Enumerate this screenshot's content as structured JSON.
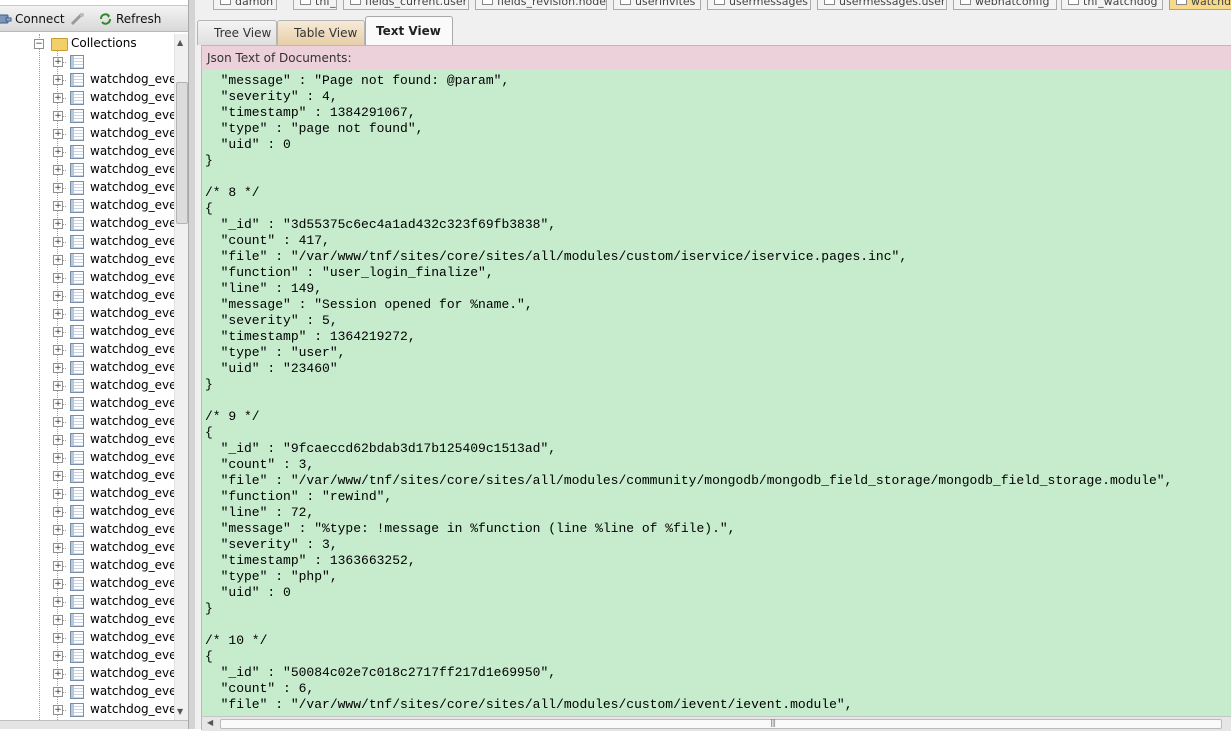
{
  "toolbar": {
    "connect_label": "Connect",
    "refresh_label": "Refresh"
  },
  "tree": {
    "collections_label": "Collections",
    "first_item_label": "",
    "item_label": "watchdog_ever",
    "item_count": 37
  },
  "doc_tabs": [
    "damon",
    "tnf_core",
    "fields_current.user",
    "fields_revision.node",
    "userinvites",
    "usermessages",
    "usermessages.user",
    "webhatconfig",
    "tnf_watchdog",
    "watchd"
  ],
  "view_tabs": {
    "tree": "Tree View",
    "table": "Table View",
    "text": "Text View"
  },
  "text_view": {
    "header": "Json Text of Documents:",
    "content": "  \"message\" : \"Page not found: @param\",\n  \"severity\" : 4,\n  \"timestamp\" : 1384291067,\n  \"type\" : \"page not found\",\n  \"uid\" : 0\n}\n\n/* 8 */\n{\n  \"_id\" : \"3d55375c6ec4a1ad432c323f69fb3838\",\n  \"count\" : 417,\n  \"file\" : \"/var/www/tnf/sites/core/sites/all/modules/custom/iservice/iservice.pages.inc\",\n  \"function\" : \"user_login_finalize\",\n  \"line\" : 149,\n  \"message\" : \"Session opened for %name.\",\n  \"severity\" : 5,\n  \"timestamp\" : 1364219272,\n  \"type\" : \"user\",\n  \"uid\" : \"23460\"\n}\n\n/* 9 */\n{\n  \"_id\" : \"9fcaeccd62bdab3d17b125409c1513ad\",\n  \"count\" : 3,\n  \"file\" : \"/var/www/tnf/sites/core/sites/all/modules/community/mongodb/mongodb_field_storage/mongodb_field_storage.module\",\n  \"function\" : \"rewind\",\n  \"line\" : 72,\n  \"message\" : \"%type: !message in %function (line %line of %file).\",\n  \"severity\" : 3,\n  \"timestamp\" : 1363663252,\n  \"type\" : \"php\",\n  \"uid\" : 0\n}\n\n/* 10 */\n{\n  \"_id\" : \"50084c02e7c018c2717ff217d1e69950\",\n  \"count\" : 6,\n  \"file\" : \"/var/www/tnf/sites/core/sites/all/modules/custom/ievent/ievent.module\","
  },
  "colors": {
    "code_background": "#c6ebcd",
    "header_background": "#ecd0da",
    "table_tab": "#e6cfa8"
  }
}
